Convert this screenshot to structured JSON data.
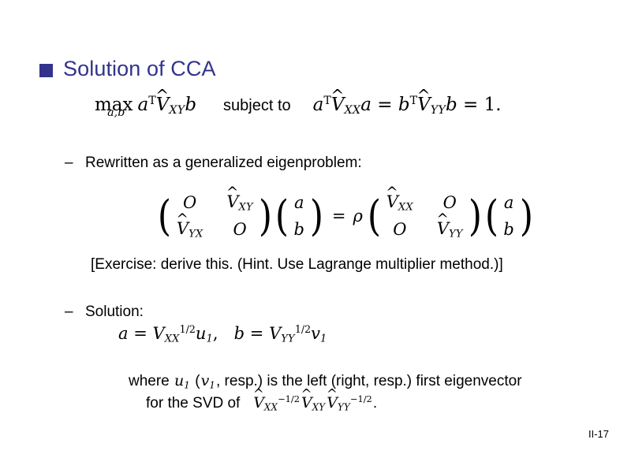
{
  "slide": {
    "title": "Solution of CCA",
    "page_number": "II-17",
    "accent_color": "#33338c",
    "background_color": "#ffffff",
    "text_color": "#000000"
  },
  "objective": {
    "max_operator": "max",
    "max_limit": "a,b",
    "maximand": {
      "a": "a",
      "transpose": "T",
      "matrix": "V",
      "matrix_hat": "^",
      "matrix_subscript": "XY",
      "b": "b"
    },
    "connector": "subject to",
    "constraint": {
      "left_a": "a",
      "left_transpose": "T",
      "left_matrix": "V",
      "left_hat": "^",
      "left_subscript": "XX",
      "left_a2": "a",
      "equals1": "=",
      "right_b": "b",
      "right_transpose": "T",
      "right_matrix": "V",
      "right_hat": "^",
      "right_subscript": "YY",
      "right_b2": "b",
      "equals2": "=",
      "value": "1."
    }
  },
  "bullets": {
    "dash": "–",
    "rewritten_label": "Rewritten as a generalized eigenproblem:",
    "solution_label": "Solution:"
  },
  "matrix_equation": {
    "lhs_matrix": [
      [
        "O",
        "V"
      ],
      [
        "V",
        "O"
      ]
    ],
    "lhs_matrix_hat": [
      [
        "",
        "^"
      ],
      [
        "^",
        ""
      ]
    ],
    "lhs_matrix_subscripts": [
      [
        "",
        "XY"
      ],
      [
        "YX",
        ""
      ]
    ],
    "lhs_vector": [
      "a",
      "b"
    ],
    "equals": "=",
    "scalar": "ρ",
    "rhs_matrix": [
      [
        "V",
        "O"
      ],
      [
        "O",
        "V"
      ]
    ],
    "rhs_matrix_hat": [
      [
        "^",
        ""
      ],
      [
        "",
        "^"
      ]
    ],
    "rhs_matrix_subscripts": [
      [
        "XX",
        ""
      ],
      [
        "",
        "YY"
      ]
    ],
    "rhs_vector": [
      "a",
      "b"
    ]
  },
  "exercise": {
    "open": "[",
    "text": "Exercise: derive this. (Hint. Use Lagrange multiplier method.)",
    "close": "]"
  },
  "solution_formula": {
    "a_symbol": "a",
    "a_equals": "=",
    "a_matrix": "V",
    "a_subscript": "XX",
    "a_superscript": "1/2",
    "a_vector": "u",
    "a_vector_index": "1",
    "separator": ",",
    "b_symbol": "b",
    "b_equals": "=",
    "b_matrix": "V",
    "b_subscript": "YY",
    "b_superscript": "1/2",
    "b_vector": "v",
    "b_vector_index": "1"
  },
  "where_block": {
    "line1_pre": "where",
    "line1_u": "u",
    "line1_u_index": "1",
    "line1_mid_open": "(",
    "line1_v": "v",
    "line1_v_index": "1",
    "line1_post": ", resp.) is the left (right, resp.) first eigenvector",
    "line2_pre": "for the SVD of",
    "line2_m1": "V",
    "line2_m1_hat": "^",
    "line2_m1_sub": "XX",
    "line2_m1_sup": "−1/2",
    "line2_m2": "V",
    "line2_m2_hat": "^",
    "line2_m2_sub": "XY",
    "line2_m3": "V",
    "line2_m3_hat": "^",
    "line2_m3_sub": "YY",
    "line2_m3_sup": "−1/2",
    "line2_period": "."
  }
}
